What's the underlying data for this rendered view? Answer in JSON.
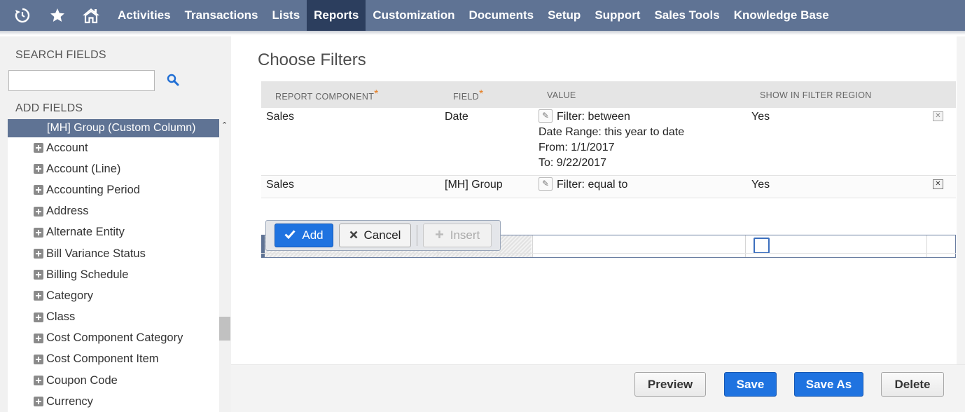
{
  "nav": {
    "items": [
      {
        "label": "Activities"
      },
      {
        "label": "Transactions"
      },
      {
        "label": "Lists"
      },
      {
        "label": "Reports",
        "active": true
      },
      {
        "label": "Customization"
      },
      {
        "label": "Documents"
      },
      {
        "label": "Setup"
      },
      {
        "label": "Support"
      },
      {
        "label": "Sales Tools"
      },
      {
        "label": "Knowledge Base"
      }
    ],
    "icons": [
      "recent-history-icon",
      "star-icon",
      "home-icon"
    ],
    "color": "#5f7394",
    "active_color": "#2c3e5e"
  },
  "sidebar": {
    "search_heading": "SEARCH FIELDS",
    "search_value": "",
    "add_heading": "ADD FIELDS",
    "selected_item": "[MH] Group (Custom Column)",
    "items": [
      "Account",
      "Account (Line)",
      "Accounting Period",
      "Address",
      "Alternate Entity",
      "Bill Variance Status",
      "Billing Schedule",
      "Category",
      "Class",
      "Cost Component Category",
      "Cost Component Item",
      "Coupon Code",
      "Currency"
    ]
  },
  "main": {
    "title": "Choose Filters",
    "columns": {
      "component": "REPORT COMPONENT",
      "field": "FIELD",
      "value": "VALUE",
      "show": "SHOW IN FILTER REGION",
      "required_mark": "*"
    },
    "rows": [
      {
        "component": "Sales",
        "field": "Date",
        "value_lines": [
          "Filter: between",
          "Date Range: this year to date",
          "From: 1/1/2017",
          "To: 9/22/2017"
        ],
        "show": "Yes"
      },
      {
        "component": "Sales",
        "field": "[MH] Group",
        "value_lines": [
          "Filter: equal to"
        ],
        "show": "Yes"
      }
    ],
    "edit_buttons": {
      "add": "Add",
      "cancel": "Cancel",
      "insert": "Insert"
    }
  },
  "footer": {
    "preview": "Preview",
    "save": "Save",
    "save_as": "Save As",
    "delete": "Delete"
  },
  "colors": {
    "primary_button": "#1f73e0",
    "required_star": "#e67e22"
  }
}
